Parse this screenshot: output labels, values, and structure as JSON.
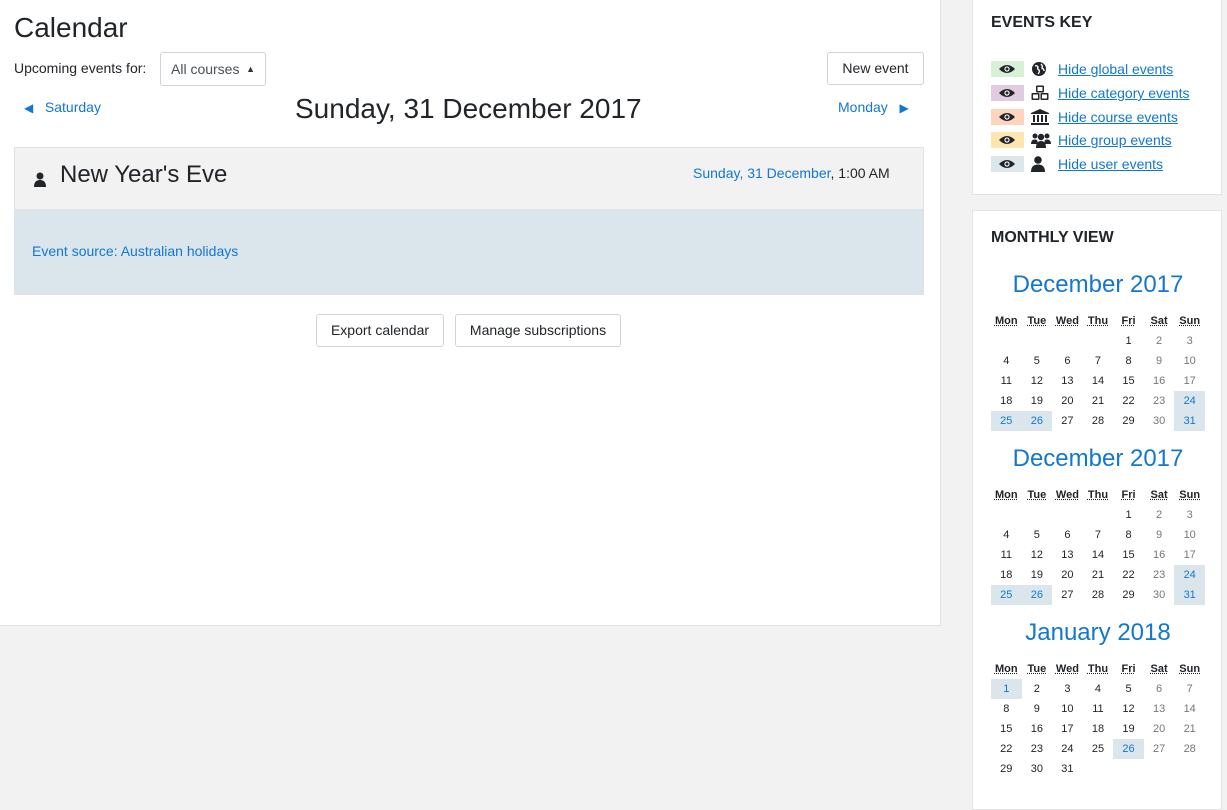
{
  "page": {
    "title": "Calendar",
    "upcoming_label": "Upcoming events for:",
    "course_select_value": "All courses",
    "new_event_label": "New event",
    "prev_day": "Saturday",
    "next_day": "Monday",
    "day_title": "Sunday, 31 December 2017"
  },
  "event": {
    "name": "New Year's Eve",
    "date_link": "Sunday, 31 December",
    "time": ", 1:00 AM",
    "source": "Event source: Australian holidays"
  },
  "actions": {
    "export_label": "Export calendar",
    "manage_label": "Manage subscriptions"
  },
  "events_key": {
    "title": "EVENTS KEY",
    "items": [
      {
        "label": "Hide global events",
        "icon": "globe-icon",
        "color": "#d6f1d6"
      },
      {
        "label": "Hide category events",
        "icon": "cubes-icon",
        "color": "#e0cbe0"
      },
      {
        "label": "Hide course events",
        "icon": "university-icon",
        "color": "#ffd3bd"
      },
      {
        "label": "Hide group events",
        "icon": "users-icon",
        "color": "#fee7ae"
      },
      {
        "label": "Hide user events",
        "icon": "user-icon",
        "color": "#dce7ec"
      }
    ]
  },
  "monthly_view": {
    "title": "MONTHLY VIEW",
    "weekdays": [
      "Mon",
      "Tue",
      "Wed",
      "Thu",
      "Fri",
      "Sat",
      "Sun"
    ],
    "months": [
      {
        "title": "December 2017",
        "weeks": [
          [
            "",
            "",
            "",
            "",
            "1",
            "2",
            "3"
          ],
          [
            "4",
            "5",
            "6",
            "7",
            "8",
            "9",
            "10"
          ],
          [
            "11",
            "12",
            "13",
            "14",
            "15",
            "16",
            "17"
          ],
          [
            "18",
            "19",
            "20",
            "21",
            "22",
            "23",
            "24"
          ],
          [
            "25",
            "26",
            "27",
            "28",
            "29",
            "30",
            "31"
          ]
        ],
        "highlighted": [
          "24",
          "25",
          "26",
          "31"
        ]
      },
      {
        "title": "December 2017",
        "weeks": [
          [
            "",
            "",
            "",
            "",
            "1",
            "2",
            "3"
          ],
          [
            "4",
            "5",
            "6",
            "7",
            "8",
            "9",
            "10"
          ],
          [
            "11",
            "12",
            "13",
            "14",
            "15",
            "16",
            "17"
          ],
          [
            "18",
            "19",
            "20",
            "21",
            "22",
            "23",
            "24"
          ],
          [
            "25",
            "26",
            "27",
            "28",
            "29",
            "30",
            "31"
          ]
        ],
        "highlighted": [
          "24",
          "25",
          "26",
          "31"
        ]
      },
      {
        "title": "January 2018",
        "weeks": [
          [
            "1",
            "2",
            "3",
            "4",
            "5",
            "6",
            "7"
          ],
          [
            "8",
            "9",
            "10",
            "11",
            "12",
            "13",
            "14"
          ],
          [
            "15",
            "16",
            "17",
            "18",
            "19",
            "20",
            "21"
          ],
          [
            "22",
            "23",
            "24",
            "25",
            "26",
            "27",
            "28"
          ],
          [
            "29",
            "30",
            "31",
            "",
            "",
            "",
            ""
          ]
        ],
        "highlighted": [
          "1",
          "26"
        ]
      }
    ]
  },
  "colors": {
    "link": "#1177d1",
    "event_body": "#dae6ec"
  }
}
